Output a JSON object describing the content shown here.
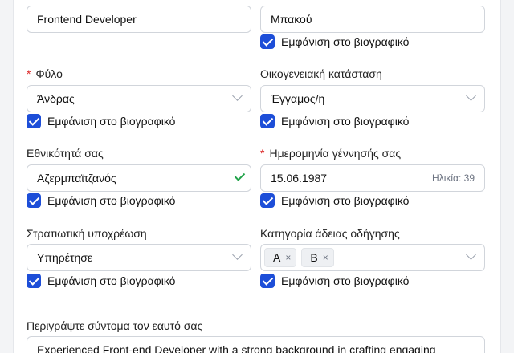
{
  "fields": {
    "position": {
      "value": "Frontend Developer"
    },
    "surname": {
      "value": "Μπακού",
      "show_label": "Εμφάνιση στο βιογραφικό"
    },
    "gender": {
      "label": "Φύλο",
      "required_mark": "*",
      "value": "Άνδρας",
      "show_label": "Εμφάνιση στο βιογραφικό"
    },
    "marital": {
      "label": "Οικογενειακή κατάσταση",
      "value": "Έγγαμος/η",
      "show_label": "Εμφάνιση στο βιογραφικό"
    },
    "nationality": {
      "label": "Εθνικότητά σας",
      "value": "Αζερμπαϊτζανός",
      "show_label": "Εμφάνιση στο βιογραφικό"
    },
    "birthdate": {
      "label": "Ημερομηνία γέννησής σας",
      "required_mark": "*",
      "value": "15.06.1987",
      "age": "Ηλικία: 39",
      "show_label": "Εμφάνιση στο βιογραφικό"
    },
    "military": {
      "label": "Στρατιωτική υποχρέωση",
      "value": "Υπηρέτησε",
      "show_label": "Εμφάνιση στο βιογραφικό"
    },
    "license": {
      "label": "Κατηγορία άδειας οδήγησης",
      "tags": [
        "A",
        "B"
      ],
      "remove_glyph": "×",
      "show_label": "Εμφάνιση στο βιογραφικό"
    },
    "about": {
      "label": "Περιγράψτε σύντομα τον εαυτό σας",
      "value": "Experienced Front-end Developer with a strong background in crafting engaging"
    }
  },
  "colors": {
    "accent": "#1d4ed8",
    "required": "#dc2626",
    "valid": "#22a34a"
  },
  "icons": [
    "chevron-down-icon",
    "checkmark-icon",
    "checkbox-checked-icon",
    "tag-remove-icon"
  ]
}
